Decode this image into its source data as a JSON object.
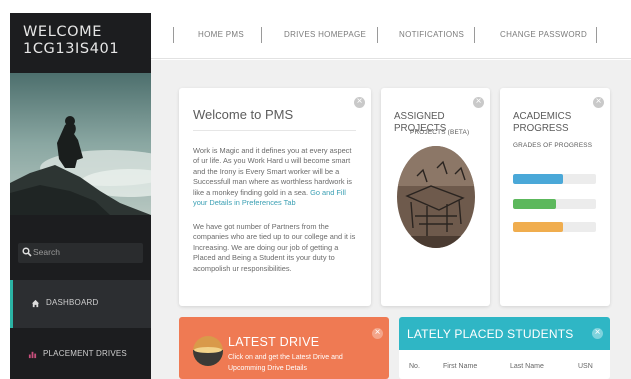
{
  "sidebar": {
    "welcome_line1": "WELCOME",
    "welcome_line2": "1CG13IS401",
    "search_placeholder": "Search",
    "items": [
      {
        "label": "DASHBOARD",
        "icon": "home-icon"
      },
      {
        "label": "PLACEMENT DRIVES",
        "icon": "bar-chart-icon"
      }
    ]
  },
  "topnav": {
    "items": [
      "HOME PMS",
      "DRIVES HOMEPAGE",
      "NOTIFICATIONS",
      "CHANGE PASSWORD"
    ]
  },
  "welcome_card": {
    "title": "Welcome to PMS",
    "para1": "Work is Magic and it defines you at every aspect of ur life. As you Work Hard u will become smart and the Irony is Every Smart worker will be a Successfull man where as worthless hardwork is like a monkey finding gold in a sea.",
    "para1_link": "Go and Fill your Details in Preferences Tab",
    "para2": "We have got number of Partners from the companies who are tied up to our college and it is Increasing. We are doing our job of getting a Placed and Being a Student its your duty to acompolish ur responsibilities."
  },
  "projects_card": {
    "title": "ASSIGNED PROJECTS",
    "subtitle": "PROJECTS (BETA)"
  },
  "academics_card": {
    "title_line1": "ACADEMICS",
    "title_line2": "PROGRESS",
    "subtitle": "GRADES OF PROGRESS",
    "progress": [
      {
        "fraction": 0.6,
        "color": "#4aa8d8"
      },
      {
        "fraction": 0.52,
        "color": "#5cb85c"
      },
      {
        "fraction": 0.6,
        "color": "#f0ad4e"
      }
    ]
  },
  "latest_drive": {
    "title": "LATEST DRIVE",
    "description": "Click on and get the Latest Drive and Upcomming Drive Details"
  },
  "placed_students": {
    "title": "LATELY PLACED STUDENTS",
    "columns": [
      "No.",
      "First Name",
      "Last Name",
      "USN"
    ]
  },
  "colors": {
    "sidebar_bg": "#1c1d1f",
    "accent_teal": "#2fb6c5",
    "drive_orange": "#ef7a53"
  }
}
